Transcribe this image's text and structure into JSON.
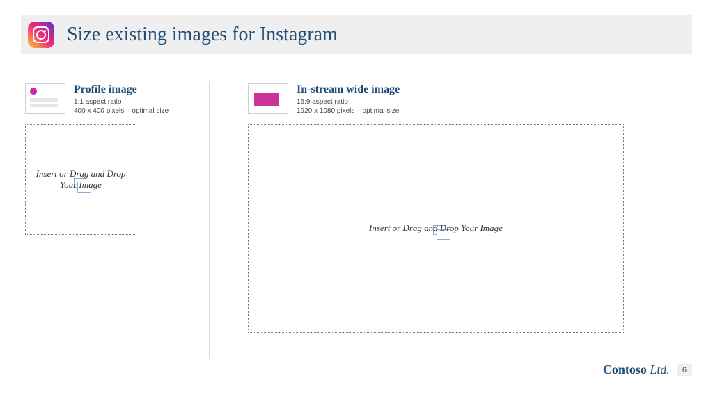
{
  "title": "Size existing images for Instagram",
  "profile": {
    "heading": "Profile image",
    "ratio": "1:1 aspect ratio",
    "size": "400 x 400 pixels – optimal size",
    "drop_text": "Insert or Drag and Drop Your Image"
  },
  "wide": {
    "heading": "In-stream wide image",
    "ratio": "16:9 aspect ratio",
    "size": "1920 x 1080 pixels – optimal size",
    "drop_text": "Insert or Drag and Drop Your Image"
  },
  "footer": {
    "company_bold": "Contoso",
    "company_rest": " Ltd.",
    "page": "6"
  }
}
